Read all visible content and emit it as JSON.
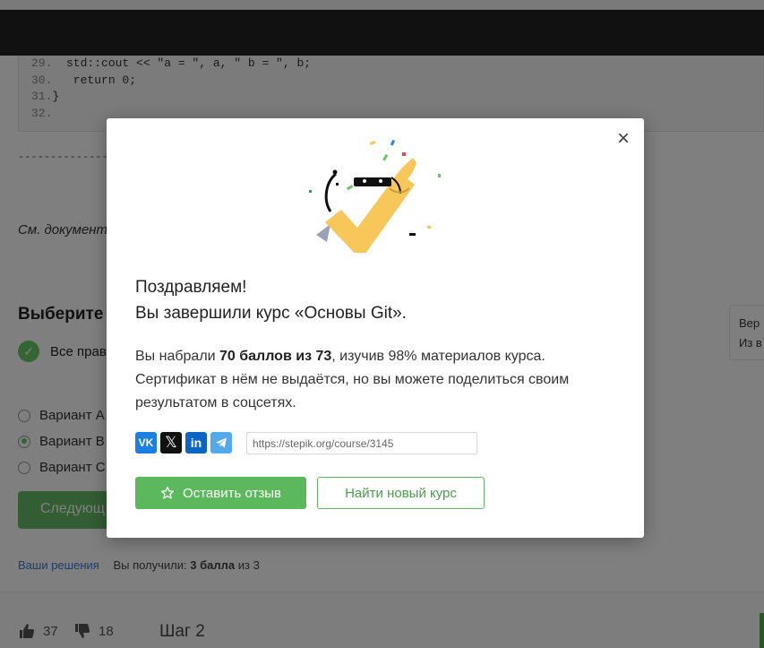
{
  "background": {
    "code_lines": [
      {
        "num": "29.",
        "text": "  std::cout << \"a = \", a, \" b = \", b;"
      },
      {
        "num": "30.",
        "text": "   return 0;"
      },
      {
        "num": "31.",
        "text": "}"
      },
      {
        "num": "32.",
        "text": ""
      }
    ],
    "dashes": "------------------",
    "see_doc": "См. документ",
    "choose_heading": "Выберите",
    "correct_text": "Все прав",
    "options": [
      "Вариант А",
      "Вариант В",
      "Вариант С"
    ],
    "selected_option_index": 1,
    "next_button": "Следующ",
    "side_card_line1": "Вер",
    "side_card_line2": "Из в",
    "solutions_link": "Ваши решения",
    "score_prefix": "Вы получили:",
    "score_value": "3 балла",
    "score_suffix": "из 3",
    "likes": "37",
    "dislikes": "18",
    "step_label": "Шаг 2"
  },
  "modal": {
    "title_line1": "Поздравляем!",
    "title_line2": "Вы завершили курс «Основы Git».",
    "desc_part1": "Вы набрали ",
    "desc_bold": "70 баллов из 73",
    "desc_part2": ", изучив 98% материалов курса. Сертификат в нём не выдаётся, но вы можете поделиться своим результатом в соцсетях.",
    "share_icons": [
      "vk-icon",
      "x-icon",
      "linkedin-icon",
      "telegram-icon"
    ],
    "share_url": "https://stepik.org/course/3145",
    "review_button": "Оставить отзыв",
    "new_course_button": "Найти новый курс",
    "accent_color": "#5cb85c"
  }
}
